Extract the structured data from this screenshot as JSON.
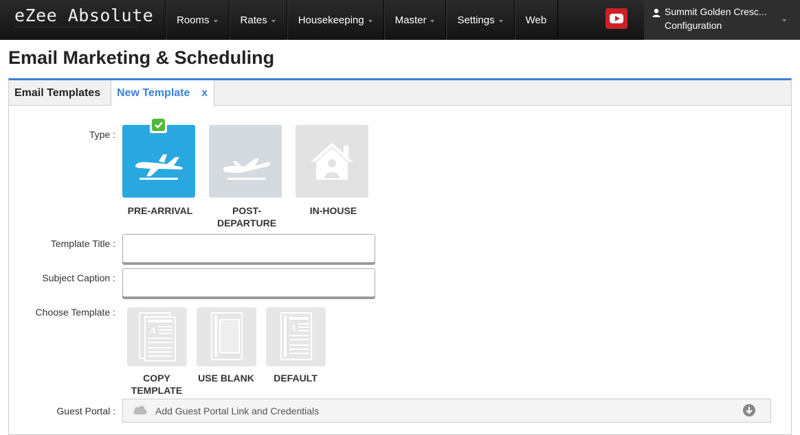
{
  "app": {
    "logo": "eZee Absolute"
  },
  "nav": {
    "items": [
      {
        "label": "Rooms",
        "has_caret": true
      },
      {
        "label": "Rates",
        "has_caret": true
      },
      {
        "label": "Housekeeping",
        "has_caret": true
      },
      {
        "label": "Master",
        "has_caret": true
      },
      {
        "label": "Settings",
        "has_caret": true
      },
      {
        "label": "Web",
        "has_caret": false
      }
    ],
    "youtube_icon": "youtube-icon",
    "account": {
      "property": "Summit Golden Cresc...",
      "section": "Configuration",
      "icon": "user-icon"
    }
  },
  "page": {
    "title": "Email Marketing & Scheduling"
  },
  "tabs": [
    {
      "label": "Email Templates",
      "active": false
    },
    {
      "label": "New Template",
      "active": true,
      "close": "x"
    }
  ],
  "form": {
    "type_label": "Type :",
    "types": [
      {
        "label": "PRE-ARRIVAL",
        "icon": "plane-landing-icon",
        "selected": true,
        "color": "#29a8e0"
      },
      {
        "label": "POST-\nDEPARTURE",
        "icon": "plane-departure-icon",
        "selected": false,
        "color": "#d4dbe0"
      },
      {
        "label": "IN-HOUSE",
        "icon": "house-guest-icon",
        "selected": false,
        "color": "#e2e2e2"
      }
    ],
    "template_title_label": "Template Title :",
    "template_title_value": "",
    "subject_caption_label": "Subject Caption :",
    "subject_caption_value": "",
    "choose_template_label": "Choose Template :",
    "templates": [
      {
        "label": "COPY\nTEMPLATE",
        "icon": "copy-template-icon"
      },
      {
        "label": "USE BLANK",
        "icon": "blank-template-icon"
      },
      {
        "label": "DEFAULT",
        "icon": "default-template-icon"
      }
    ],
    "guest_portal_label": "Guest Portal :",
    "guest_portal_text": "Add Guest Portal Link and Credentials"
  },
  "colors": {
    "accent": "#3d7fd9",
    "selected_type": "#29a8e0",
    "check": "#52b83a",
    "youtube": "#cc2027"
  }
}
